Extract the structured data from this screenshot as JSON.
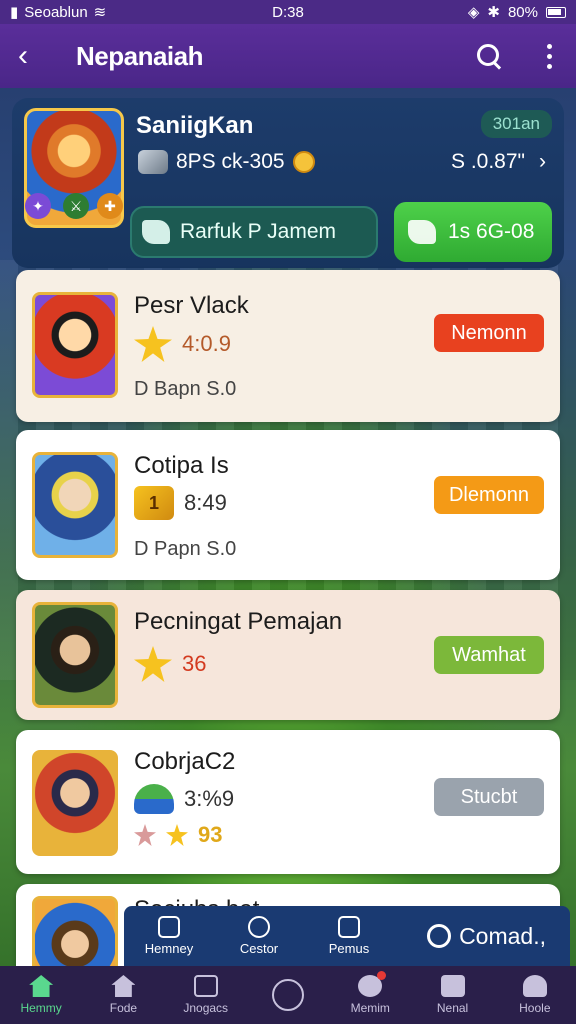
{
  "status_bar": {
    "carrier": "Seoablun",
    "time": "D:38",
    "battery": "80%"
  },
  "app_bar": {
    "title": "Nepanaiah"
  },
  "profile": {
    "name": "SaniigKan",
    "level": "301an",
    "stat": "8PS ck-305",
    "balance": "S .0.87\"",
    "action_left": "Rarfuk P Jamem",
    "action_right": "1s 6G-08"
  },
  "items": [
    {
      "name": "Pesr Vlack",
      "rating": "4:0.9",
      "price": "D Bapn  S.0",
      "button": "Nemonn",
      "button_color": "#e8411f",
      "bg": "#f7efe4"
    },
    {
      "name": "Cotipa Is",
      "rating": "8:49",
      "price": "D Papn  S.0",
      "button": "Dlemonn",
      "button_color": "#f49a16",
      "bg": "#ffffff"
    },
    {
      "name": "Pecningat Pemajan",
      "rating": "36",
      "price": "",
      "button": "Wamhat",
      "button_color": "#7cb83a",
      "bg": "#f6e6db"
    },
    {
      "name": "CobrjaC2",
      "rating": "3:%9",
      "price": "93",
      "button": "Stucbt",
      "button_color": "#9aa3ad",
      "bg": "#ffffff"
    },
    {
      "name": "Seciubs bat",
      "rating": "",
      "price": "",
      "button": "",
      "button_color": "#9aa3ad",
      "bg": "#ffffff"
    }
  ],
  "float_bar": {
    "items": [
      "Hemney",
      "Cestor",
      "Pemus"
    ],
    "primary": "Comad.,"
  },
  "bottom_nav": {
    "items": [
      "Hemmy",
      "Fode",
      "Jnogacs",
      "",
      "Memim",
      "Nenal",
      "Hoole"
    ]
  }
}
